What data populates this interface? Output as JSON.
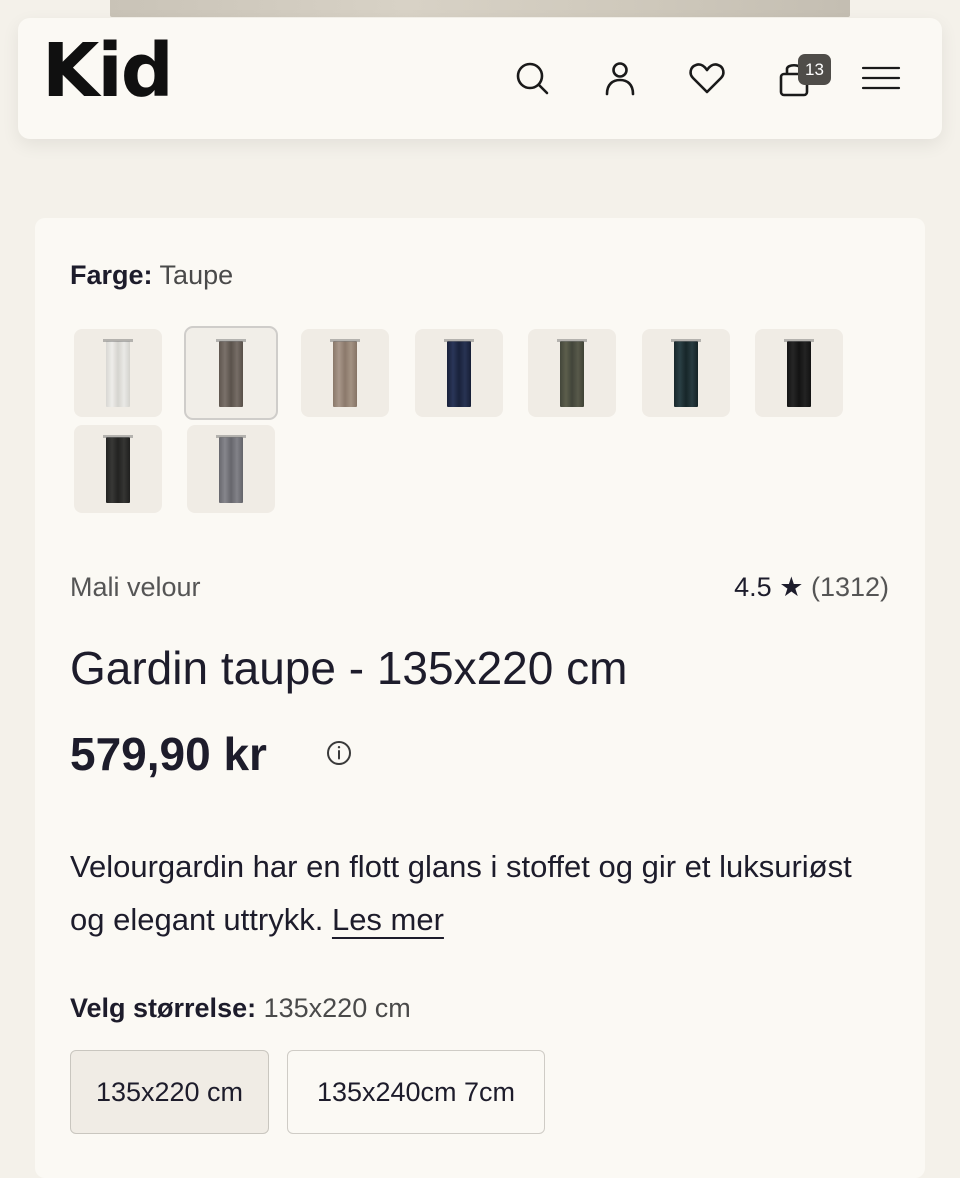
{
  "header": {
    "logo": "Kid",
    "cart_count": "13",
    "icons": [
      "search-icon",
      "user-icon",
      "heart-icon",
      "cart-icon",
      "menu-icon"
    ]
  },
  "product": {
    "color_label": "Farge:",
    "color_value": "Taupe",
    "swatches": [
      {
        "name": "white",
        "color": "#e4e3df"
      },
      {
        "name": "taupe",
        "color": "#6e655d"
      },
      {
        "name": "beige",
        "color": "#9c8a7c"
      },
      {
        "name": "navy",
        "color": "#1f2a47"
      },
      {
        "name": "olive",
        "color": "#4f5140"
      },
      {
        "name": "dark-green",
        "color": "#1f3236"
      },
      {
        "name": "black",
        "color": "#1b1b1b"
      },
      {
        "name": "charcoal",
        "color": "#2c2c2a"
      },
      {
        "name": "grey",
        "color": "#77777d"
      }
    ],
    "selected_swatch": "taupe",
    "brand": "Mali velour",
    "rating": "4.5",
    "rating_star": "★",
    "review_count": "(1312)",
    "title": "Gardin taupe - 135x220 cm",
    "price": "579,90 kr",
    "description": "Velourgardin har en flott glans i stoffet og gir et luksuriøst og elegant uttrykk.",
    "read_more": "Les mer",
    "size_label": "Velg størrelse:",
    "size_value": "135x220 cm",
    "sizes": [
      "135x220 cm",
      "135x240cm 7cm"
    ]
  }
}
